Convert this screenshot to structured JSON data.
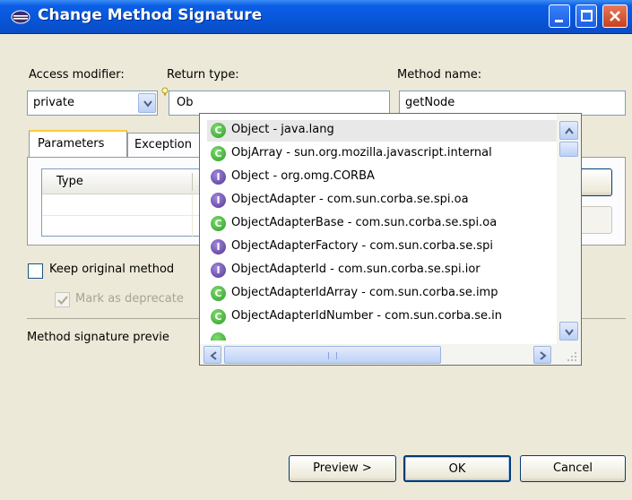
{
  "window": {
    "title": "Change Method Signature"
  },
  "labels": {
    "access_modifier": "Access modifier:",
    "return_type": "Return type:",
    "method_name": "Method name:"
  },
  "fields": {
    "access_modifier_value": "private",
    "return_type_value": "Ob",
    "method_name_value": "getNode"
  },
  "tabs": [
    {
      "label": "Parameters"
    },
    {
      "label": "Exception"
    }
  ],
  "table": {
    "columns": [
      "Type"
    ]
  },
  "checkboxes": {
    "keep_original": "Keep original method",
    "mark_deprecated": "Mark as deprecate"
  },
  "preview_label": "Method signature previe",
  "buttons": {
    "preview": "Preview >",
    "ok": "OK",
    "cancel": "Cancel"
  },
  "completion": {
    "items": [
      {
        "icon": "class-icon",
        "text": "Object - java.lang"
      },
      {
        "icon": "class-icon",
        "text": "ObjArray - sun.org.mozilla.javascript.internal"
      },
      {
        "icon": "interface-icon",
        "text": "Object - org.omg.CORBA"
      },
      {
        "icon": "interface-icon",
        "text": "ObjectAdapter - com.sun.corba.se.spi.oa"
      },
      {
        "icon": "class-icon",
        "text": "ObjectAdapterBase - com.sun.corba.se.spi.oa"
      },
      {
        "icon": "interface-icon",
        "text": "ObjectAdapterFactory - com.sun.corba.se.spi"
      },
      {
        "icon": "interface-icon",
        "text": "ObjectAdapterId - com.sun.corba.se.spi.ior"
      },
      {
        "icon": "class-icon",
        "text": "ObjectAdapterIdArray - com.sun.corba.se.imp"
      },
      {
        "icon": "class-icon",
        "text": "ObjectAdapterIdNumber - com.sun.corba.se.in"
      }
    ]
  },
  "colors": {
    "titlebar": "#0656d8",
    "dialog_bg": "#ece9d8",
    "field_border": "#7f9db9",
    "class_icon": "#2f9a2a",
    "interface_icon": "#53328e"
  }
}
